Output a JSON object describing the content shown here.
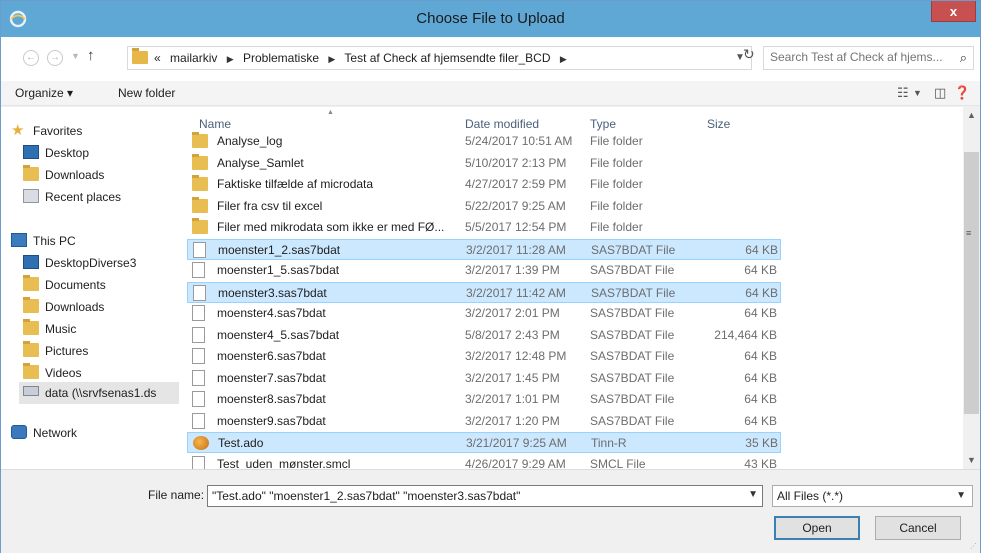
{
  "window": {
    "title": "Choose File to Upload",
    "close_label": "x"
  },
  "address": {
    "back_glyph": "←",
    "forward_glyph": "→",
    "up_glyph": "↑",
    "overflow": "«",
    "crumbs": [
      "mailarkiv",
      "Problematiske",
      "Test af Check af hjemsendte filer_BCD"
    ],
    "refresh_glyph": "↻"
  },
  "search": {
    "placeholder": "Search Test af Check af hjems...",
    "icon": "search-icon"
  },
  "toolbar": {
    "organize_label": "Organize ▾",
    "new_folder_label": "New folder"
  },
  "sidebar": {
    "favorites": {
      "label": "Favorites",
      "items": [
        "Desktop",
        "Downloads",
        "Recent places"
      ]
    },
    "this_pc": {
      "label": "This PC",
      "items": [
        "DesktopDiverse3",
        "Documents",
        "Downloads",
        "Music",
        "Pictures",
        "Videos",
        "data (\\\\srvfsenas1.ds"
      ]
    },
    "network": {
      "label": "Network"
    }
  },
  "columns": {
    "name": "Name",
    "date": "Date modified",
    "type": "Type",
    "size": "Size"
  },
  "files": [
    {
      "name": "Analyse_log",
      "date": "5/24/2017 10:51 AM",
      "type": "File folder",
      "size": "",
      "kind": "folder",
      "selected": false
    },
    {
      "name": "Analyse_Samlet",
      "date": "5/10/2017 2:13 PM",
      "type": "File folder",
      "size": "",
      "kind": "folder",
      "selected": false
    },
    {
      "name": "Faktiske tilfælde af microdata",
      "date": "4/27/2017 2:59 PM",
      "type": "File folder",
      "size": "",
      "kind": "folder",
      "selected": false
    },
    {
      "name": "Filer fra csv til excel",
      "date": "5/22/2017 9:25 AM",
      "type": "File folder",
      "size": "",
      "kind": "folder",
      "selected": false
    },
    {
      "name": "Filer med mikrodata som ikke er med FØ...",
      "date": "5/5/2017 12:54 PM",
      "type": "File folder",
      "size": "",
      "kind": "folder",
      "selected": false
    },
    {
      "name": "moenster1_2.sas7bdat",
      "date": "3/2/2017 11:28 AM",
      "type": "SAS7BDAT File",
      "size": "64 KB",
      "kind": "file",
      "selected": true
    },
    {
      "name": "moenster1_5.sas7bdat",
      "date": "3/2/2017 1:39 PM",
      "type": "SAS7BDAT File",
      "size": "64 KB",
      "kind": "file",
      "selected": false
    },
    {
      "name": "moenster3.sas7bdat",
      "date": "3/2/2017 11:42 AM",
      "type": "SAS7BDAT File",
      "size": "64 KB",
      "kind": "file",
      "selected": true
    },
    {
      "name": "moenster4.sas7bdat",
      "date": "3/2/2017 2:01 PM",
      "type": "SAS7BDAT File",
      "size": "64 KB",
      "kind": "file",
      "selected": false
    },
    {
      "name": "moenster4_5.sas7bdat",
      "date": "5/8/2017 2:43 PM",
      "type": "SAS7BDAT File",
      "size": "214,464 KB",
      "kind": "file",
      "selected": false
    },
    {
      "name": "moenster6.sas7bdat",
      "date": "3/2/2017 12:48 PM",
      "type": "SAS7BDAT File",
      "size": "64 KB",
      "kind": "file",
      "selected": false
    },
    {
      "name": "moenster7.sas7bdat",
      "date": "3/2/2017 1:45 PM",
      "type": "SAS7BDAT File",
      "size": "64 KB",
      "kind": "file",
      "selected": false
    },
    {
      "name": "moenster8.sas7bdat",
      "date": "3/2/2017 1:01 PM",
      "type": "SAS7BDAT File",
      "size": "64 KB",
      "kind": "file",
      "selected": false
    },
    {
      "name": "moenster9.sas7bdat",
      "date": "3/2/2017 1:20 PM",
      "type": "SAS7BDAT File",
      "size": "64 KB",
      "kind": "file",
      "selected": false
    },
    {
      "name": "Test.ado",
      "date": "3/21/2017 9:25 AM",
      "type": "Tinn-R",
      "size": "35 KB",
      "kind": "tinnr",
      "selected": true
    },
    {
      "name": "Test_uden_mønster.smcl",
      "date": "4/26/2017 9:29 AM",
      "type": "SMCL File",
      "size": "43 KB",
      "kind": "file",
      "selected": false
    }
  ],
  "filename": {
    "label": "File name:",
    "value": "\"Test.ado\" \"moenster1_2.sas7bdat\" \"moenster3.sas7bdat\""
  },
  "filter": {
    "value": "All Files (*.*)"
  },
  "buttons": {
    "open": "Open",
    "cancel": "Cancel"
  },
  "colors": {
    "titlebar": "#5fa8d6",
    "close": "#c75050",
    "selection": "#cce8ff",
    "folder": "#e8bd52"
  }
}
